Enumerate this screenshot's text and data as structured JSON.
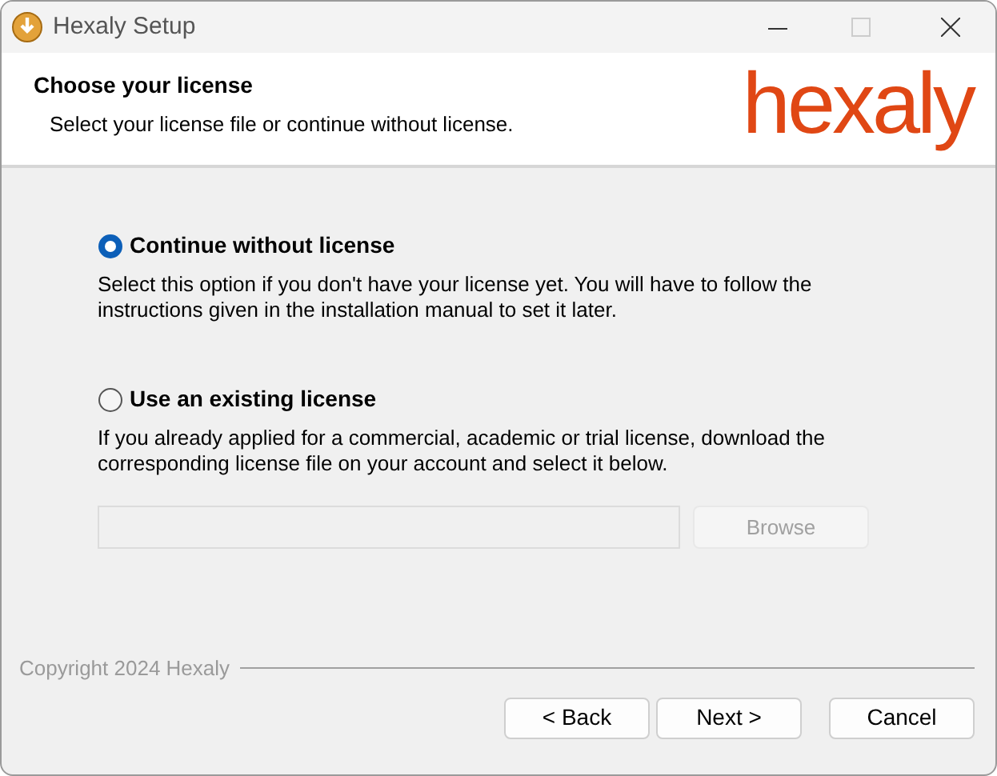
{
  "window": {
    "title": "Hexaly Setup"
  },
  "header": {
    "title": "Choose your license",
    "subtitle": "Select your license file or continue without license.",
    "logo": "hexaly"
  },
  "options": [
    {
      "label": "Continue without license",
      "selected": true,
      "description": "Select this option if you don't have your license yet. You will have to follow the instructions given in the installation manual to set it later."
    },
    {
      "label": "Use an existing license",
      "selected": false,
      "description": "If you already applied for a commercial, academic or trial license, download the corresponding license file on your account and select it below."
    }
  ],
  "license_file": {
    "disabled": true
  },
  "browse_button": {
    "label": "Browse",
    "disabled": true
  },
  "copyright": "Copyright 2024 Hexaly",
  "buttons": [
    {
      "label": "< Back"
    },
    {
      "label": "Next >"
    },
    {
      "label": "Cancel"
    }
  ]
}
